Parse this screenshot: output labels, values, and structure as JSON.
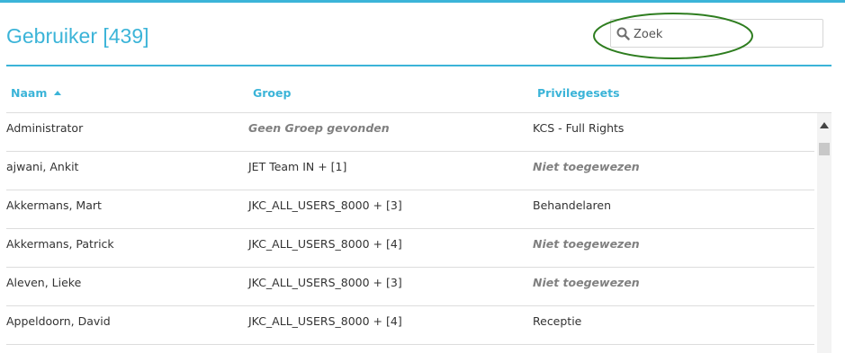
{
  "header": {
    "title": "Gebruiker [439]",
    "accent_color": "#3bb4d8"
  },
  "search": {
    "placeholder": "Zoek",
    "value": "",
    "icon": "search-icon"
  },
  "annotation": {
    "shape": "ellipse",
    "color": "#2e7d1f"
  },
  "table": {
    "columns": [
      {
        "label": "Naam",
        "sort": "ascending"
      },
      {
        "label": "Groep"
      },
      {
        "label": "Privilegesets"
      }
    ],
    "rows": [
      {
        "name": "Administrator",
        "group": "Geen Groep gevonden",
        "privileges": "KCS - Full Rights"
      },
      {
        "name": "ajwani, Ankit",
        "group": "JET Team IN + [1]",
        "privileges": "Niet toegewezen"
      },
      {
        "name": "Akkermans, Mart",
        "group": "JKC_ALL_USERS_8000 + [3]",
        "privileges": "Behandelaren"
      },
      {
        "name": "Akkermans, Patrick",
        "group": "JKC_ALL_USERS_8000 + [4]",
        "privileges": "Niet toegewezen"
      },
      {
        "name": "Aleven, Lieke",
        "group": "JKC_ALL_USERS_8000 + [3]",
        "privileges": "Niet toegewezen"
      },
      {
        "name": "Appeldoorn, David",
        "group": "JKC_ALL_USERS_8000 + [4]",
        "privileges": "Receptie"
      }
    ]
  }
}
